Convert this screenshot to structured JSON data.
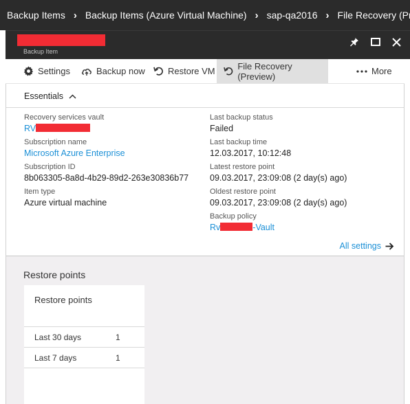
{
  "breadcrumb": [
    "Backup Items",
    "Backup Items (Azure Virtual Machine)",
    "sap-qa2016",
    "File Recovery (Preview"
  ],
  "blade": {
    "subtitle": "Backup Item"
  },
  "commands": [
    {
      "label": "Settings",
      "icon": "gear-icon"
    },
    {
      "label": "Backup now",
      "icon": "backup-cloud-icon"
    },
    {
      "label": "Restore VM",
      "icon": "restore-arrow-icon"
    },
    {
      "label": "File Recovery (Preview)",
      "icon": "restore-arrow-icon",
      "active": true
    },
    {
      "label": "More",
      "icon": "ellipsis-icon"
    }
  ],
  "essentials": {
    "title": "Essentials",
    "left": [
      {
        "label": "Recovery services vault",
        "value": "RV",
        "link": true
      },
      {
        "label": "Subscription name",
        "value": "Microsoft Azure Enterprise",
        "link": true
      },
      {
        "label": "Subscription ID",
        "value": "8b063305-8a8d-4b29-89d2-263e30836b77"
      },
      {
        "label": "Item type",
        "value": "Azure virtual machine"
      }
    ],
    "right": [
      {
        "label": "Last backup status",
        "value": "Failed"
      },
      {
        "label": "Last backup time",
        "value": "12.03.2017, 10:12:48"
      },
      {
        "label": "Latest restore point",
        "value": "09.03.2017, 23:09:08 (2 day(s) ago)"
      },
      {
        "label": "Oldest restore point",
        "value": "09.03.2017, 23:09:08 (2 day(s) ago)"
      },
      {
        "label": "Backup policy",
        "value_prefix": "Rv",
        "value_suffix": "-Vault",
        "link": true
      }
    ],
    "all_settings": "All settings"
  },
  "restore_points": {
    "section_title": "Restore points",
    "tile_title": "Restore points",
    "rows": [
      {
        "label": "Last 30 days",
        "count": "1"
      },
      {
        "label": "Last 7 days",
        "count": "1"
      }
    ]
  },
  "colors": {
    "header_bg": "#2b2b2b",
    "accent_link": "#1a8fd6",
    "redaction": "#f22c34",
    "active_command": "#e0e0e0"
  }
}
